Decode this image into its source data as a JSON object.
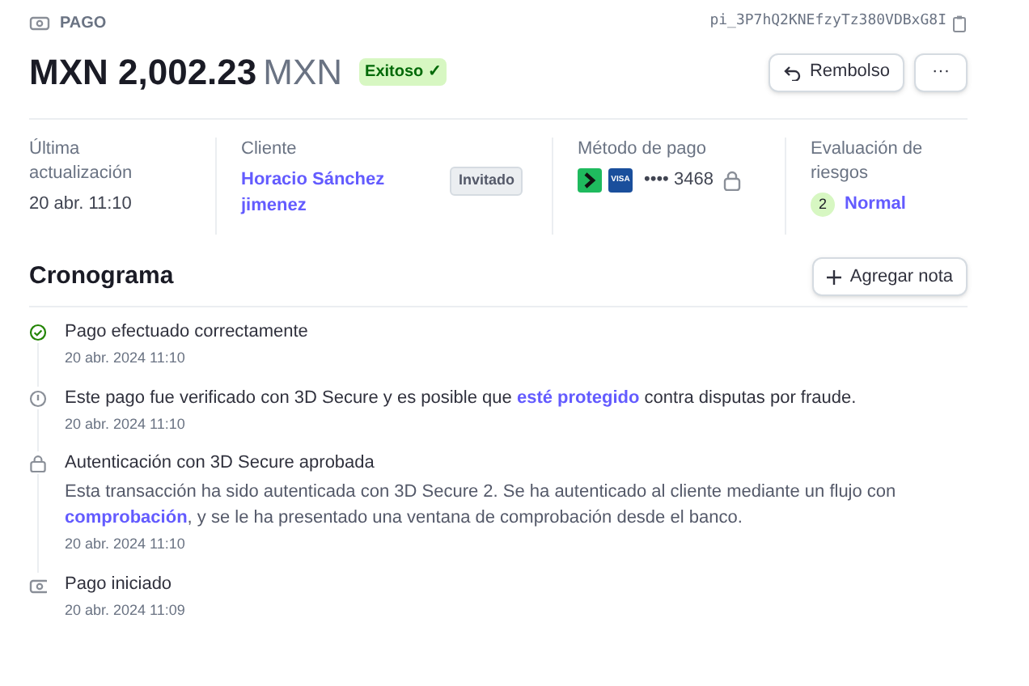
{
  "header": {
    "label": "PAGO",
    "payment_id": "pi_3P7hQ2KNEfzyTz380VDBxG8I",
    "amount": "MXN 2,002.23",
    "currency": "MXN",
    "status": "Exitoso ✓",
    "buttons": [
      {
        "kind": "refund",
        "label": "Rembolso"
      },
      {
        "kind": "more",
        "label": "···"
      }
    ]
  },
  "summary": [
    {
      "kind": "date",
      "label": "Última actualización",
      "value": "20 abr. 11:10"
    },
    {
      "kind": "customer",
      "label": "Cliente",
      "value": "Horacio Sánchez jimenez",
      "badge": "Invitado"
    },
    {
      "kind": "method",
      "label": "Método de pago",
      "value": "•••• 3468",
      "card_text": "VISA"
    },
    {
      "kind": "risk",
      "label": "Evaluación de riesgos",
      "score": "2",
      "value": "Normal"
    }
  ],
  "timeline": {
    "title": "Cronograma",
    "button": "Agregar nota",
    "events": [
      {
        "kind": "success",
        "title": [
          {
            "kind": "text",
            "text": "Pago efectuado correctamente"
          }
        ],
        "time": "20 abr. 2024 11:10"
      },
      {
        "kind": "notice",
        "title": [
          {
            "kind": "text",
            "text": "Este pago fue verificado con 3D Secure y es posible que "
          },
          {
            "kind": "link",
            "text": "esté protegido"
          },
          {
            "kind": "text",
            "text": " contra disputas por fraude."
          }
        ],
        "time": "20 abr. 2024 11:10"
      },
      {
        "kind": "authentication",
        "title": [
          {
            "kind": "text",
            "text": "Autenticación con 3D Secure aprobada"
          }
        ],
        "body": [
          {
            "kind": "text",
            "text": "Esta transacción ha sido autenticada con 3D Secure 2. Se ha autenticado al cliente mediante un flujo con "
          },
          {
            "kind": "link",
            "text": "comprobación"
          },
          {
            "kind": "text",
            "text": ", y se le ha presentado una ventana de comprobación desde el banco."
          }
        ],
        "time": "20 abr. 2024 11:10"
      },
      {
        "kind": "created",
        "title": [
          {
            "kind": "text",
            "text": "Pago iniciado"
          }
        ],
        "time": "20 abr. 2024 11:09"
      }
    ]
  }
}
